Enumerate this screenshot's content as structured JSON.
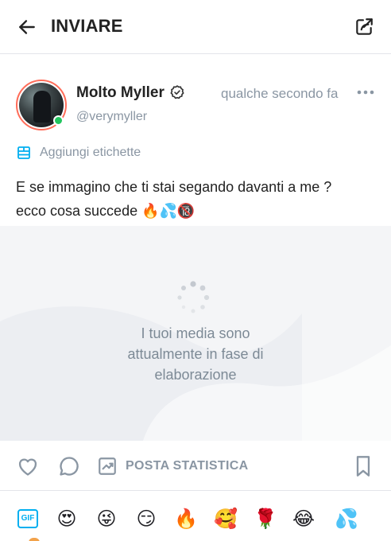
{
  "header": {
    "title": "INVIARE",
    "back_icon": "arrow-left-icon",
    "share_icon": "share-icon"
  },
  "post": {
    "author_name": "Molto Myller",
    "author_handle": "@verymyller",
    "verified": true,
    "online": true,
    "time": "qualche secondo fa",
    "tags_label": "Aggiungi etichette",
    "text_line1": "E se immagino che ti stai segando davanti a me ?",
    "text_line2": "ecco cosa succede 🔥💦🔞",
    "media_message_line1": "I tuoi media sono",
    "media_message_line2": "attualmente in fase di",
    "media_message_line3": "elaborazione"
  },
  "actions": {
    "stats_label": "POSTA STATISTICA"
  },
  "emoji_bar": {
    "gif_label": "GIF",
    "emojis": [
      "😍",
      "😜",
      "😏",
      "🔥",
      "🥰",
      "🌹",
      "😂",
      "💦"
    ]
  },
  "colors": {
    "accent": "#00aff0",
    "muted": "#8a96a3",
    "online": "#22c55e",
    "avatar_ring": "#ff6d5a"
  }
}
